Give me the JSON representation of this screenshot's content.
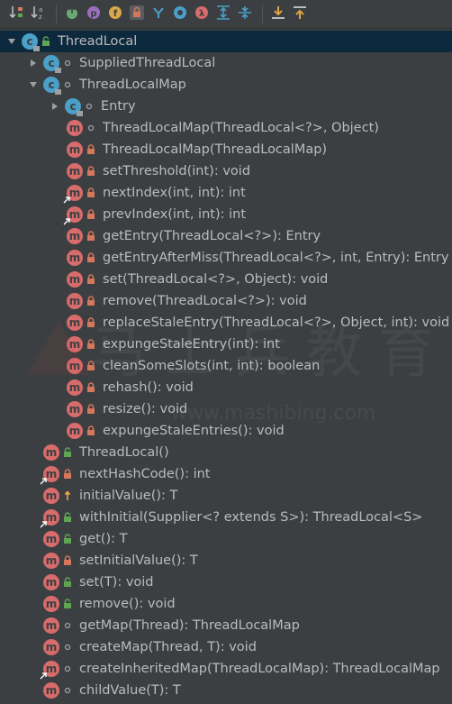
{
  "colors": {
    "background": "#3c3f41",
    "selection": "#0d293e",
    "method_icon": "#d86b6b",
    "class_icon": "#4aa0c9",
    "lock": "#d5775a",
    "unlock": "#5ea653",
    "text": "#bbbbbb"
  },
  "toolbar": {
    "buttons": [
      {
        "icon": "sort-by-visibility-icon"
      },
      {
        "icon": "sort-alphabetically-icon"
      },
      {
        "icon": "show-inherited-icon"
      },
      {
        "icon": "show-properties-icon"
      },
      {
        "icon": "show-fields-icon"
      },
      {
        "icon": "show-non-public-icon"
      },
      {
        "icon": "show-lambdas-icon"
      },
      {
        "icon": "show-anonymous-icon"
      },
      {
        "icon": "show-lambda-icon"
      },
      {
        "icon": "expand-all-icon"
      },
      {
        "icon": "collapse-all-icon"
      },
      {
        "icon": "autoscroll-to-source-icon"
      },
      {
        "icon": "autoscroll-from-source-icon"
      }
    ]
  },
  "tree": [
    {
      "label": "ThreadLocal",
      "kind": "class",
      "visibility": "public",
      "arrow": "expanded",
      "level": 0,
      "selected": true
    },
    {
      "label": "SuppliedThreadLocal",
      "kind": "class",
      "visibility": "package",
      "arrow": "collapsed",
      "level": 1
    },
    {
      "label": "ThreadLocalMap",
      "kind": "class",
      "visibility": "package",
      "arrow": "expanded",
      "level": 1
    },
    {
      "label": "Entry",
      "kind": "class",
      "visibility": "package",
      "arrow": "collapsed",
      "level": 2
    },
    {
      "label": "ThreadLocalMap(ThreadLocal<?>, Object)",
      "kind": "method",
      "visibility": "package",
      "level": 2
    },
    {
      "label": "ThreadLocalMap(ThreadLocalMap)",
      "kind": "method",
      "visibility": "private",
      "level": 2
    },
    {
      "label": "setThreshold(int): void",
      "kind": "method",
      "visibility": "private",
      "level": 2
    },
    {
      "label": "nextIndex(int, int): int",
      "kind": "method",
      "visibility": "private",
      "level": 2,
      "static": true
    },
    {
      "label": "prevIndex(int, int): int",
      "kind": "method",
      "visibility": "private",
      "level": 2,
      "static": true
    },
    {
      "label": "getEntry(ThreadLocal<?>): Entry",
      "kind": "method",
      "visibility": "private",
      "level": 2
    },
    {
      "label": "getEntryAfterMiss(ThreadLocal<?>, int, Entry): Entry",
      "kind": "method",
      "visibility": "private",
      "level": 2
    },
    {
      "label": "set(ThreadLocal<?>, Object): void",
      "kind": "method",
      "visibility": "private",
      "level": 2
    },
    {
      "label": "remove(ThreadLocal<?>): void",
      "kind": "method",
      "visibility": "private",
      "level": 2
    },
    {
      "label": "replaceStaleEntry(ThreadLocal<?>, Object, int): void",
      "kind": "method",
      "visibility": "private",
      "level": 2
    },
    {
      "label": "expungeStaleEntry(int): int",
      "kind": "method",
      "visibility": "private",
      "level": 2
    },
    {
      "label": "cleanSomeSlots(int, int): boolean",
      "kind": "method",
      "visibility": "private",
      "level": 2
    },
    {
      "label": "rehash(): void",
      "kind": "method",
      "visibility": "private",
      "level": 2
    },
    {
      "label": "resize(): void",
      "kind": "method",
      "visibility": "private",
      "level": 2
    },
    {
      "label": "expungeStaleEntries(): void",
      "kind": "method",
      "visibility": "private",
      "level": 2
    },
    {
      "label": "ThreadLocal()",
      "kind": "method",
      "visibility": "public",
      "level": 1
    },
    {
      "label": "nextHashCode(): int",
      "kind": "method",
      "visibility": "private",
      "level": 1,
      "static": true
    },
    {
      "label": "initialValue(): T",
      "kind": "method",
      "visibility": "protected",
      "level": 1
    },
    {
      "label": "withInitial(Supplier<? extends S>): ThreadLocal<S>",
      "kind": "method",
      "visibility": "public",
      "level": 1,
      "static": true
    },
    {
      "label": "get(): T",
      "kind": "method",
      "visibility": "public",
      "level": 1
    },
    {
      "label": "setInitialValue(): T",
      "kind": "method",
      "visibility": "private",
      "level": 1
    },
    {
      "label": "set(T): void",
      "kind": "method",
      "visibility": "public",
      "level": 1
    },
    {
      "label": "remove(): void",
      "kind": "method",
      "visibility": "public",
      "level": 1
    },
    {
      "label": "getMap(Thread): ThreadLocalMap",
      "kind": "method",
      "visibility": "package",
      "level": 1
    },
    {
      "label": "createMap(Thread, T): void",
      "kind": "method",
      "visibility": "package",
      "level": 1
    },
    {
      "label": "createInheritedMap(ThreadLocalMap): ThreadLocalMap",
      "kind": "method",
      "visibility": "package",
      "level": 1,
      "static": true
    },
    {
      "label": "childValue(T): T",
      "kind": "method",
      "visibility": "package",
      "level": 1
    }
  ],
  "watermark": {
    "chinese": "马士兵教育",
    "url": "www.mashibing.com"
  }
}
